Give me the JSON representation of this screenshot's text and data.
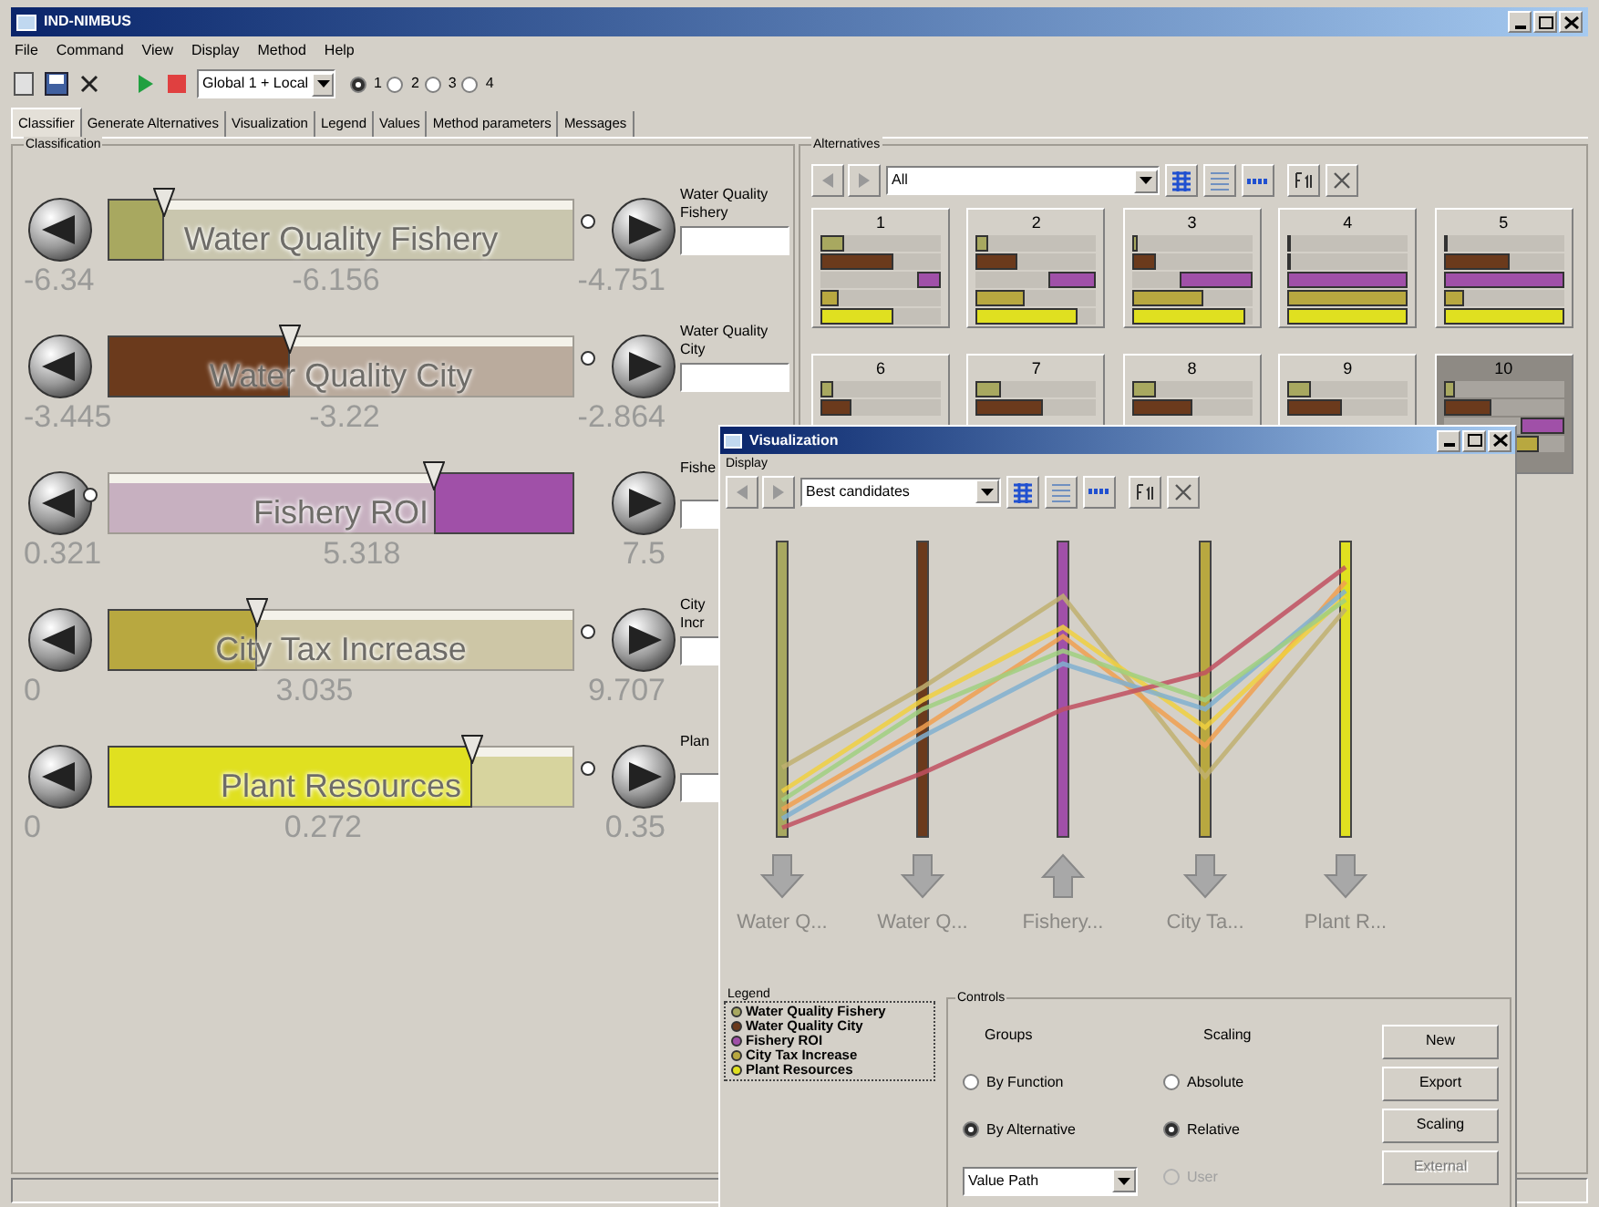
{
  "window": {
    "title": "IND-NIMBUS"
  },
  "menu": [
    "File",
    "Command",
    "View",
    "Display",
    "Method",
    "Help"
  ],
  "toolbar": {
    "mode": "Global 1 + Local",
    "options": [
      {
        "label": "1",
        "selected": true
      },
      {
        "label": "2",
        "selected": false
      },
      {
        "label": "3",
        "selected": false
      },
      {
        "label": "4",
        "selected": false
      }
    ]
  },
  "tabs": [
    {
      "label": "Classifier",
      "selected": true
    },
    {
      "label": "Generate Alternatives",
      "selected": false
    },
    {
      "label": "Visualization",
      "selected": false
    },
    {
      "label": "Legend",
      "selected": false
    },
    {
      "label": "Values",
      "selected": false
    },
    {
      "label": "Method parameters",
      "selected": false
    },
    {
      "label": "Messages",
      "selected": false
    }
  ],
  "classification": {
    "title": "Classification",
    "criteria": [
      {
        "name": "Water Quality Fishery",
        "color": "#a8a860",
        "level": 0.12,
        "kind": "forward",
        "min": "-6.34",
        "value": "-6.156",
        "max": "-4.751",
        "field_label": [
          "Water Quality",
          "Fishery"
        ]
      },
      {
        "name": "Water Quality City",
        "color": "#6b3a1c",
        "level": 0.39,
        "kind": "forward",
        "min": "-3.445",
        "value": "-3.22",
        "max": "-2.864",
        "field_label": [
          "Water Quality",
          "City"
        ]
      },
      {
        "name": "Fishery ROI",
        "color": "#a050a8",
        "level": 0.3,
        "kind": "reverse",
        "min": "0.321",
        "value": "5.318",
        "max": "7.5",
        "field_label": [
          "Fishe"
        ]
      },
      {
        "name": "City Tax Increase",
        "color": "#b8a840",
        "level": 0.32,
        "kind": "forward",
        "min": "0",
        "value": "3.035",
        "max": "9.707",
        "field_label": [
          "City",
          "Incr"
        ]
      },
      {
        "name": "Plant Resources",
        "color": "#e0e020",
        "level": 0.78,
        "kind": "forward",
        "min": "0",
        "value": "0.272",
        "max": "0.35",
        "field_label": [
          "Plan"
        ]
      }
    ]
  },
  "alternatives": {
    "title": "Alternatives",
    "filter": "All",
    "cards": [
      {
        "label": "1",
        "selected": false,
        "bars": [
          {
            "level": 0.2
          },
          {
            "level": 0.6
          },
          {
            "level": 0.2
          },
          {
            "level": 0.15
          },
          {
            "level": 0.6
          }
        ]
      },
      {
        "label": "2",
        "selected": false,
        "bars": [
          {
            "level": 0.1
          },
          {
            "level": 0.35
          },
          {
            "level": 0.4
          },
          {
            "level": 0.4
          },
          {
            "level": 0.85
          }
        ]
      },
      {
        "label": "3",
        "selected": false,
        "bars": [
          {
            "level": 0.05
          },
          {
            "level": 0.2
          },
          {
            "level": 0.6
          },
          {
            "level": 0.6
          },
          {
            "level": 0.95
          }
        ]
      },
      {
        "label": "4",
        "selected": false,
        "bars": [
          {
            "level": 0.02
          },
          {
            "level": 0.02
          },
          {
            "level": 1
          },
          {
            "level": 1
          },
          {
            "level": 1
          }
        ]
      },
      {
        "label": "5",
        "selected": false,
        "bars": [
          {
            "level": 0.03
          },
          {
            "level": 0.55
          },
          {
            "level": 1
          },
          {
            "level": 0.18
          },
          {
            "level": 1
          }
        ]
      },
      {
        "label": "6",
        "selected": false,
        "bars": [
          {
            "level": 0.1
          },
          {
            "level": 0.25
          }
        ]
      },
      {
        "label": "7",
        "selected": false,
        "bars": [
          {
            "level": 0.2
          },
          {
            "level": 0.55
          }
        ]
      },
      {
        "label": "8",
        "selected": false,
        "bars": [
          {
            "level": 0.2
          },
          {
            "level": 0.5
          }
        ]
      },
      {
        "label": "9",
        "selected": false,
        "bars": [
          {
            "level": 0.2
          },
          {
            "level": 0.45
          }
        ]
      },
      {
        "label": "10",
        "selected": true,
        "bars": [
          {
            "level": 0.1
          },
          {
            "level": 0.4
          },
          {
            "level": 0.35
          },
          {
            "level": 0.8
          }
        ]
      }
    ]
  },
  "visualization": {
    "title": "Visualization",
    "group": "Display",
    "filter": "Best candidates",
    "axes": [
      {
        "label": "Water Q...",
        "color": "#a8a860",
        "kind": "down"
      },
      {
        "label": "Water Q...",
        "color": "#6b3a1c",
        "kind": "down"
      },
      {
        "label": "Fishery...",
        "color": "#a050a8",
        "kind": "up"
      },
      {
        "label": "City Ta...",
        "color": "#b8a840",
        "kind": "down"
      },
      {
        "label": "Plant R...",
        "color": "#e0e020",
        "kind": "down"
      }
    ],
    "legend": {
      "title": "Legend",
      "items": [
        {
          "label": "Water Quality Fishery",
          "color": "#a8a860"
        },
        {
          "label": "Water Quality City",
          "color": "#6b3a1c"
        },
        {
          "label": "Fishery ROI",
          "color": "#a050a8"
        },
        {
          "label": "City Tax Increase",
          "color": "#b8a840"
        },
        {
          "label": "Plant Resources",
          "color": "#e0e020"
        }
      ]
    },
    "controls": {
      "title": "Controls",
      "groups_label": "Groups",
      "scaling_label": "Scaling",
      "groups": [
        {
          "label": "By Function",
          "selected": false
        },
        {
          "label": "By Alternative",
          "selected": true
        }
      ],
      "scaling": [
        {
          "label": "Absolute",
          "selected": false,
          "disabled": false
        },
        {
          "label": "Relative",
          "selected": true,
          "disabled": false
        },
        {
          "label": "User",
          "selected": false,
          "disabled": true
        }
      ],
      "view": "Value Path",
      "buttons": [
        {
          "label": "New",
          "disabled": false
        },
        {
          "label": "Export",
          "disabled": false
        },
        {
          "label": "Scaling",
          "disabled": false
        },
        {
          "label": "External",
          "disabled": true
        }
      ]
    }
  }
}
